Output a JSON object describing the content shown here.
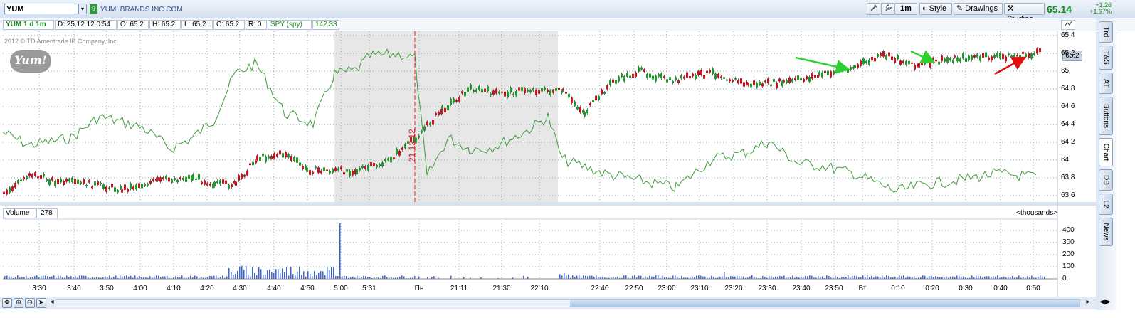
{
  "toolbar": {
    "symbol": "YUM",
    "dropdown_glyph": "▾",
    "link_badge": "9",
    "company": "YUM! BRANDS INC COM",
    "timeframe": "1m",
    "style": "Style",
    "drawings": "Drawings",
    "studies": "Studies",
    "last": "65.14",
    "net_change": "+1.26",
    "pct_change": "+1.97%"
  },
  "info": {
    "title": "YUM 1 d 1m",
    "date": "D: 25.12.12 0:54",
    "open": "O: 65.2",
    "high": "H: 65.2",
    "low": "L: 65.2",
    "close": "C: 65.2",
    "range": "R: 0",
    "compare": "SPY (spy)",
    "compare_value": "142.33"
  },
  "watermark": "2012 © TD Ameritrade IP Company, Inc.",
  "logo_text": "Yum!",
  "price_axis": {
    "ticks": [
      "65.4",
      "65.2",
      "65",
      "64.8",
      "64.6",
      "64.4",
      "64.2",
      "64",
      "63.8",
      "63.6"
    ],
    "current": "65.2"
  },
  "day_marker": "21.12.12",
  "volume": {
    "label": "Volume",
    "value": "278",
    "units": "<thousands>",
    "ticks": [
      "400",
      "300",
      "200",
      "100",
      "0"
    ]
  },
  "time_ticks": [
    "3:30",
    "3:40",
    "3:50",
    "4:00",
    "4:10",
    "4:20",
    "4:30",
    "4:40",
    "4:50",
    "5:00",
    "5:31",
    "Пн",
    "21:11",
    "21:30",
    "22:10",
    "22:40",
    "22:50",
    "23:00",
    "23:10",
    "23:20",
    "23:30",
    "23:40",
    "23:50",
    "Вт",
    "0:10",
    "0:20",
    "0:30",
    "0:40",
    "0:50"
  ],
  "sidebar_tabs": [
    "Trd",
    "T&S",
    "AT",
    "Buttons",
    "Chart",
    "DB",
    "L2",
    "News"
  ],
  "colors": {
    "up": "#1e9a2b",
    "down": "#c8141e",
    "spy": "#3f9a3a",
    "accent_green": "#138a1e"
  }
}
